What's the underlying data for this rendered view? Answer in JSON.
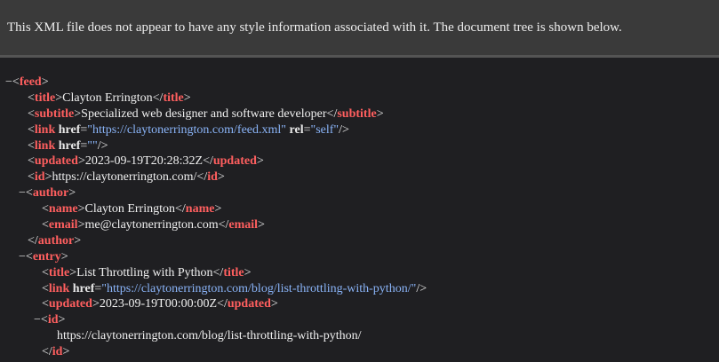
{
  "banner": {
    "message": "This XML file does not appear to have any style information associated with it. The document tree is shown below."
  },
  "toggle_symbol": "−",
  "tags": {
    "feed": "feed",
    "title": "title",
    "subtitle": "subtitle",
    "link": "link",
    "updated": "updated",
    "id": "id",
    "author": "author",
    "name": "name",
    "email": "email",
    "entry": "entry"
  },
  "attrs": {
    "href": "href",
    "rel": "rel"
  },
  "feed": {
    "title": "Clayton Errington",
    "subtitle": "Specialized web designer and software developer",
    "link1_href": "\"https://claytonerrington.com/feed.xml\"",
    "link1_rel": "\"self\"",
    "link2_href": "\"\"",
    "updated": "2023-09-19T20:28:32Z",
    "id": "https://claytonerrington.com/",
    "author": {
      "name": "Clayton Errington",
      "email": "me@claytonerrington.com"
    },
    "entry": {
      "title": "List Throttling with Python",
      "link_href": "\"https://claytonerrington.com/blog/list-throttling-with-python/\"",
      "updated": "2023-09-19T00:00:00Z",
      "id": "https://claytonerrington.com/blog/list-throttling-with-python/"
    }
  }
}
